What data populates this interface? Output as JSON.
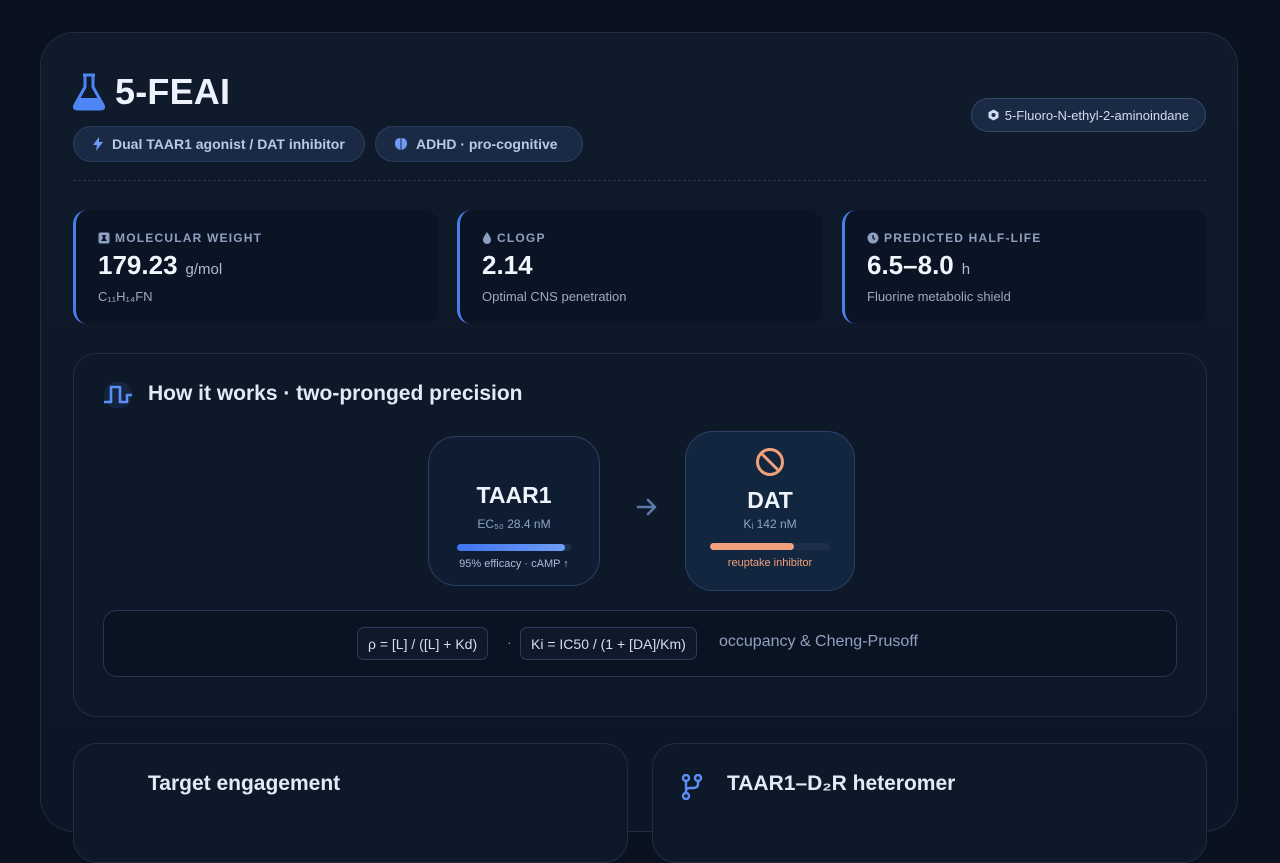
{
  "header": {
    "title": "5-FEAI",
    "pills": [
      {
        "label": "Dual TAAR1 agonist / DAT inhibitor"
      },
      {
        "label": "ADHD · pro-cognitive"
      }
    ],
    "iupac": "5-Fluoro-N-ethyl-2-aminoindane"
  },
  "stats": [
    {
      "label": "MOLECULAR WEIGHT",
      "value": "179.23",
      "unit": "g/mol",
      "sub": "C₁₁H₁₄FN",
      "icon": "flask-badge-icon"
    },
    {
      "label": "CLOGP",
      "value": "2.14",
      "unit": "",
      "sub": "Optimal CNS penetration",
      "icon": "droplet-icon"
    },
    {
      "label": "PREDICTED HALF-LIFE",
      "value": "6.5–8.0",
      "unit": "h",
      "sub": "Fluorine metabolic shield",
      "icon": "clock-icon"
    }
  ],
  "mechanism": {
    "title": "How it works · two-pronged precision",
    "taar1": {
      "name": "TAAR1",
      "meta": "EC₅₀ 28.4 nM",
      "caption": "95% efficacy · cAMP ↑",
      "fill": 0.95
    },
    "dat": {
      "name": "DAT",
      "meta": "Kᵢ 142 nM",
      "caption": "reuptake inhibitor",
      "fill": 0.7
    },
    "formula1": "ρ = [L] / ([L] + Kd)",
    "dot": "·",
    "formula2": "Ki = IC50 / (1 + [DA]/Km)",
    "note": "occupancy & Cheng-Prusoff"
  },
  "cards": {
    "left_title": "Target engagement",
    "right_title": "TAAR1–D₂R heteromer"
  },
  "colors": {
    "accent": "#4a7ee8",
    "dat_orange": "#f0a07a",
    "taar_blue": "#4f86f5"
  }
}
